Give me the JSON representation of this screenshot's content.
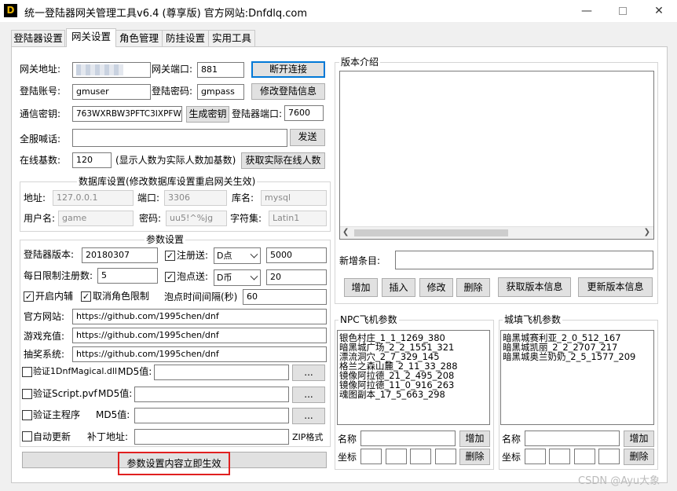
{
  "window": {
    "title": "统一登陆器网关管理工具v6.4 (尊享版)  官方网站:Dnfdlq.com",
    "app_icon": "D"
  },
  "tabs": [
    "登陆器设置",
    "网关设置",
    "角色管理",
    "防挂设置",
    "实用工具"
  ],
  "gateway": {
    "addr_label": "网关地址:",
    "port_label": "网关端口:",
    "port_value": "881",
    "disconnect_button": "断开连接",
    "account_label": "登陆账号:",
    "account_value": "gmuser",
    "password_label": "登陆密码:",
    "password_value": "gmpass",
    "modify_button": "修改登陆信息",
    "key_label": "通信密钥:",
    "key_value": "763WXRBW3PFTC3IXPFWH",
    "gen_key_button": "生成密钥",
    "launcher_port_label": "登陆器端口:",
    "launcher_port_value": "7600",
    "broadcast_label": "全服喊话:",
    "broadcast_value": "",
    "send_button": "发送",
    "online_base_label": "在线基数:",
    "online_base_value": "120",
    "online_hint": "(显示人数为实际人数加基数)",
    "get_online_button": "获取实际在线人数"
  },
  "db": {
    "title": "数据库设置(修改数据库设置重启网关生效)",
    "addr_label": "地址:",
    "addr_value": "127.0.0.1",
    "port_label": "端口:",
    "port_value": "3306",
    "dbname_label": "库名:",
    "dbname_value": "mysql",
    "user_label": "用户名:",
    "user_value": "game",
    "pass_label": "密码:",
    "pass_value": "uu5!^%jg",
    "charset_label": "字符集:",
    "charset_value": "Latin1"
  },
  "params": {
    "title": "参数设置",
    "version_label": "登陆器版本:",
    "version_value": "20180307",
    "register_gift_label": "注册送:",
    "register_gift_checked": true,
    "register_gift_type": "D点",
    "register_gift_amount": "5000",
    "daily_limit_label": "每日限制注册数:",
    "daily_limit_value": "5",
    "bubble_gift_label": "泡点送:",
    "bubble_gift_checked": true,
    "bubble_gift_type": "D币",
    "bubble_gift_amount": "20",
    "open_assist_label": "开启内辅",
    "open_assist_checked": true,
    "cancel_role_limit_label": "取消角色限制",
    "cancel_role_limit_checked": true,
    "bubble_interval_label": "泡点时间间隔(秒)",
    "bubble_interval_value": "60",
    "website_label": "官方网站:",
    "website_value": "https://github.com/1995chen/dnf",
    "recharge_label": "游戏充值:",
    "recharge_value": "https://github.com/1995chen/dnf",
    "lottery_label": "抽奖系统:",
    "lottery_value": "https://github.com/1995chen/dnf",
    "verify_dll_label": "验证1DnfMagical.dll",
    "verify_dll_checked": false,
    "md5_label_1": "MD5值:",
    "verify_pvf_label": "验证Script.pvf",
    "verify_pvf_checked": false,
    "md5_label_2": "MD5值:",
    "verify_main_label": "验证主程序",
    "verify_main_checked": false,
    "md5_label_3": "MD5值:",
    "browse_label": "...",
    "auto_update_label": "自动更新",
    "auto_update_checked": false,
    "patch_addr_label": "补丁地址:",
    "zip_label": "ZIP格式",
    "apply_notice": "参数设置内容立即生效"
  },
  "version_intro": {
    "title": "版本介绍",
    "new_entry_label": "新增条目:",
    "add_button": "增加",
    "insert_button": "插入",
    "modify_button": "修改",
    "delete_button": "删除",
    "get_info_button": "获取版本信息",
    "update_info_button": "更新版本信息"
  },
  "npc_plane": {
    "title": "NPC飞机参数",
    "items": [
      "银色村庄_1_1_1269_380",
      "暗黑城广场_2_2_1551_321",
      "漂流洞穴_2_7_329_145",
      "格兰之森山麓_2_11_33_288",
      "镜像阿拉德_21_2_495_208",
      "镜像阿拉德_11_0_916_263",
      "魂图副本_17_5_663_298"
    ],
    "name_label": "名称",
    "coord_label": "坐标",
    "add_button": "增加",
    "delete_button": "删除"
  },
  "city_plane": {
    "title": "城填飞机参数",
    "items": [
      "暗黑城赛利亚_2_0_512_167",
      "暗黑城凯丽_2_2_2707_217",
      "暗黑城奥兰奶奶_2_5_1577_209"
    ],
    "name_label": "名称",
    "coord_label": "坐标",
    "add_button": "增加",
    "delete_button": "删除"
  },
  "watermark": "CSDN @Ayu大象",
  "colors": {
    "accent": "#0078d7",
    "notice_border": "#e02020"
  }
}
